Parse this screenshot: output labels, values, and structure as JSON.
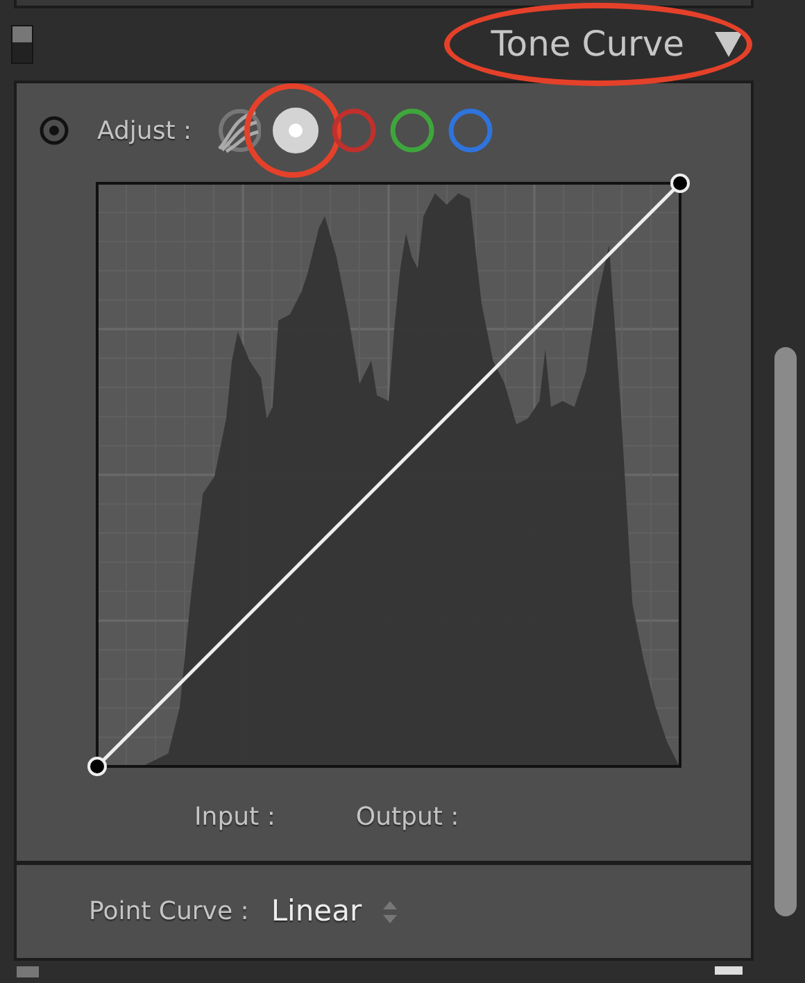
{
  "panel": {
    "switch_on": true,
    "title": "Tone Curve",
    "title_highlighted": true,
    "expanded": true
  },
  "adjust": {
    "label": "Adjust :",
    "channels": [
      {
        "kind": "region",
        "selected": false,
        "highlighted": false
      },
      {
        "kind": "rgb",
        "selected": true,
        "highlighted": true
      },
      {
        "kind": "single",
        "color": "#c0302c",
        "selected": false,
        "highlighted": false
      },
      {
        "kind": "single",
        "color": "#3fa63c",
        "selected": false,
        "highlighted": false
      },
      {
        "kind": "single",
        "color": "#2f74dc",
        "selected": false,
        "highlighted": false
      }
    ]
  },
  "curve": {
    "input_label": "Input :",
    "output_label": "Output :"
  },
  "point_curve": {
    "label": "Point Curve :",
    "value": "Linear"
  },
  "next_panel": {
    "switch_on": true
  }
}
